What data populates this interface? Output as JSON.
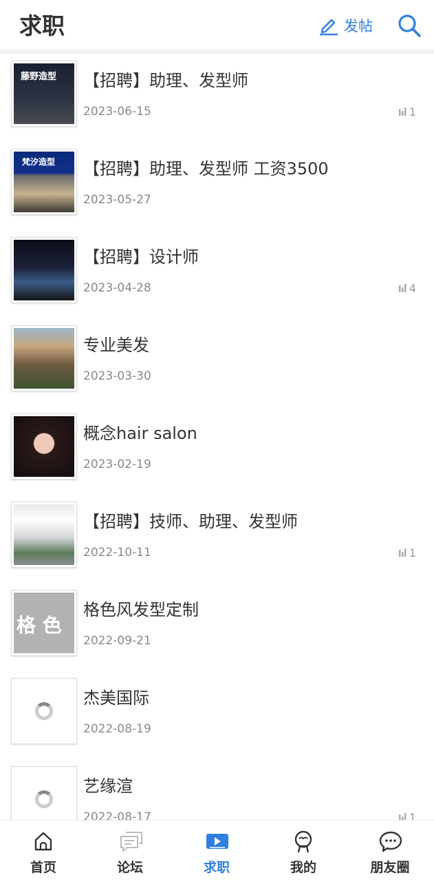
{
  "header": {
    "title": "求职",
    "post_label": "发帖",
    "post_icon": "pencil-icon",
    "search_icon": "search-icon"
  },
  "colors": {
    "accent": "#2f7fe0",
    "text": "#333333",
    "date": "#888888",
    "divider": "#f0f0f0"
  },
  "posts": [
    {
      "title": "【招聘】助理、发型师",
      "date": "2023-06-15",
      "views": "1",
      "thumb_text": "藤野造型"
    },
    {
      "title": "【招聘】助理、发型师 工资3500",
      "date": "2023-05-27",
      "views": "",
      "thumb_text": "梵汐造型"
    },
    {
      "title": "【招聘】设计师",
      "date": "2023-04-28",
      "views": "4",
      "thumb_text": ""
    },
    {
      "title": "专业美发",
      "date": "2023-03-30",
      "views": "",
      "thumb_text": ""
    },
    {
      "title": "概念hair salon",
      "date": "2023-02-19",
      "views": "",
      "thumb_text": ""
    },
    {
      "title": "【招聘】技师、助理、发型师",
      "date": "2022-10-11",
      "views": "1",
      "thumb_text": ""
    },
    {
      "title": "格色风发型定制",
      "date": "2022-09-21",
      "views": "",
      "thumb_text": "格 色"
    },
    {
      "title": "杰美国际",
      "date": "2022-08-19",
      "views": "",
      "thumb_text": ""
    },
    {
      "title": "艺缘渲",
      "date": "2022-08-17",
      "views": "1",
      "thumb_text": ""
    }
  ],
  "tabbar": {
    "items": [
      {
        "label": "首页",
        "icon": "home-icon"
      },
      {
        "label": "论坛",
        "icon": "forum-icon"
      },
      {
        "label": "求职",
        "icon": "video-play-icon",
        "active": true
      },
      {
        "label": "我的",
        "icon": "user-icon"
      },
      {
        "label": "朋友圈",
        "icon": "chat-bubbles-icon"
      }
    ]
  }
}
